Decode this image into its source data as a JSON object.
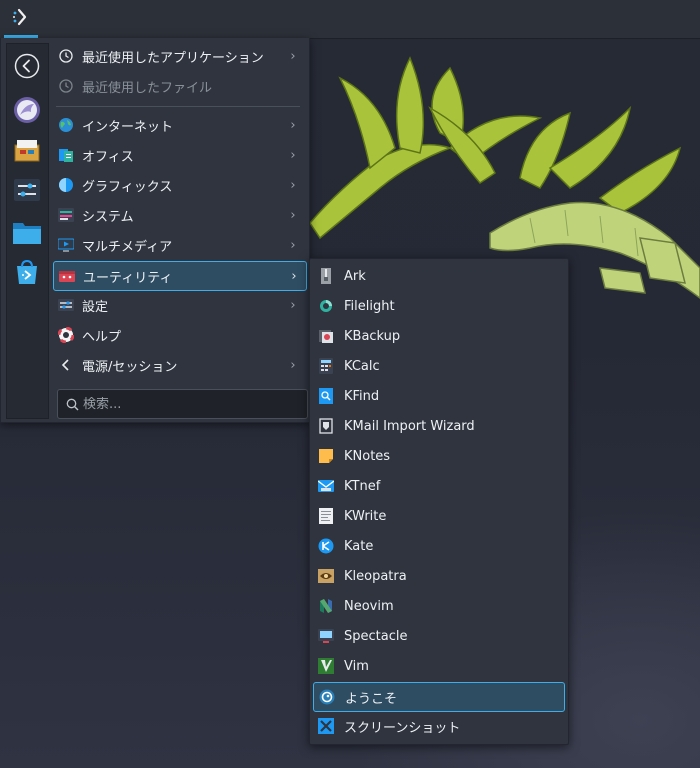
{
  "panel": {
    "launcher_icon": "kde-launcher-icon"
  },
  "favorites": [
    {
      "name": "back-icon"
    },
    {
      "name": "kdenlive-app-icon"
    },
    {
      "name": "package-app-icon"
    },
    {
      "name": "settings-app-icon"
    },
    {
      "name": "folder-app-icon"
    },
    {
      "name": "discover-app-icon"
    }
  ],
  "menu": {
    "recent_apps": "最近使用したアプリケーション",
    "recent_files": "最近使用したファイル",
    "categories": [
      {
        "label": "インターネット",
        "icon": "globe-icon"
      },
      {
        "label": "オフィス",
        "icon": "office-icon"
      },
      {
        "label": "グラフィックス",
        "icon": "graphics-icon"
      },
      {
        "label": "システム",
        "icon": "system-icon"
      },
      {
        "label": "マルチメディア",
        "icon": "multimedia-icon"
      },
      {
        "label": "ユーティリティ",
        "icon": "utilities-icon",
        "selected": true
      },
      {
        "label": "設定",
        "icon": "settings-icon"
      },
      {
        "label": "ヘルプ",
        "icon": "help-icon"
      },
      {
        "label": "電源/セッション",
        "icon": "power-session-icon"
      }
    ],
    "search_placeholder": "検索..."
  },
  "submenu": {
    "items": [
      {
        "label": "Ark",
        "icon": "ark-icon"
      },
      {
        "label": "Filelight",
        "icon": "filelight-icon"
      },
      {
        "label": "KBackup",
        "icon": "kbackup-icon"
      },
      {
        "label": "KCalc",
        "icon": "kcalc-icon"
      },
      {
        "label": "KFind",
        "icon": "kfind-icon"
      },
      {
        "label": "KMail Import Wizard",
        "icon": "kmail-import-icon"
      },
      {
        "label": "KNotes",
        "icon": "knotes-icon"
      },
      {
        "label": "KTnef",
        "icon": "ktnef-icon"
      },
      {
        "label": "KWrite",
        "icon": "kwrite-icon"
      },
      {
        "label": "Kate",
        "icon": "kate-icon"
      },
      {
        "label": "Kleopatra",
        "icon": "kleopatra-icon"
      },
      {
        "label": "Neovim",
        "icon": "neovim-icon"
      },
      {
        "label": "Spectacle",
        "icon": "spectacle-icon"
      },
      {
        "label": "Vim",
        "icon": "vim-icon"
      },
      {
        "label": "ようこそ",
        "icon": "welcome-icon",
        "selected": true
      },
      {
        "label": "スクリーンショット",
        "icon": "screenshot-icon"
      }
    ]
  },
  "colors": {
    "accent": "#3daee9",
    "selection_bg": "#2e4d63",
    "menu_bg": "#2f343e",
    "panel_bg": "#2c3038"
  }
}
